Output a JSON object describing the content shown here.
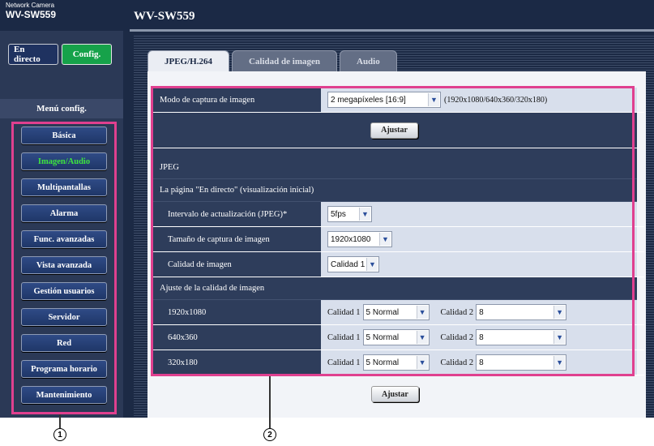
{
  "header": {
    "brand_sub": "Network Camera",
    "brand_model": "WV-SW559",
    "page_title": "WV-SW559"
  },
  "sidebar": {
    "live_label": "En directo",
    "config_label": "Config.",
    "menu_title": "Menú config.",
    "items": [
      {
        "label": "Básica",
        "active": false
      },
      {
        "label": "Imagen/Audio",
        "active": true
      },
      {
        "label": "Multipantallas",
        "active": false
      },
      {
        "label": "Alarma",
        "active": false
      },
      {
        "label": "Func. avanzadas",
        "active": false
      },
      {
        "label": "Vista avanzada",
        "active": false
      },
      {
        "label": "Gestión usuarios",
        "active": false
      },
      {
        "label": "Servidor",
        "active": false
      },
      {
        "label": "Red",
        "active": false
      },
      {
        "label": "Programa horario",
        "active": false
      },
      {
        "label": "Mantenimiento",
        "active": false
      }
    ]
  },
  "tabs": [
    {
      "label": "JPEG/H.264",
      "active": true
    },
    {
      "label": "Calidad de imagen",
      "active": false
    },
    {
      "label": "Audio",
      "active": false
    }
  ],
  "form": {
    "capture_mode_label": "Modo de captura de imagen",
    "capture_mode_value": "2 megapíxeles [16:9]",
    "capture_mode_note": "(1920x1080/640x360/320x180)",
    "apply_label": "Ajustar",
    "jpeg_section": "JPEG",
    "live_page_section": "La página \"En directo\" (visualización inicial)",
    "refresh_label": "Intervalo de actualización (JPEG)*",
    "refresh_value": "5fps",
    "size_label": "Tamaño de captura de imagen",
    "size_value": "1920x1080",
    "quality_label": "Calidad de imagen",
    "quality_value": "Calidad 1",
    "quality_adjust_section": "Ajuste de la calidad de imagen",
    "quality1_label": "Calidad 1",
    "quality2_label": "Calidad 2",
    "resolutions": [
      {
        "name": "1920x1080",
        "q1": "5 Normal",
        "q2": "8"
      },
      {
        "name": "640x360",
        "q1": "5 Normal",
        "q2": "8"
      },
      {
        "name": "320x180",
        "q1": "5 Normal",
        "q2": "8"
      }
    ]
  },
  "callouts": {
    "one": "1",
    "two": "2"
  },
  "colors": {
    "highlight": "#e0408f",
    "active_menu": "#3ee53e",
    "config_green": "#16a24a"
  }
}
